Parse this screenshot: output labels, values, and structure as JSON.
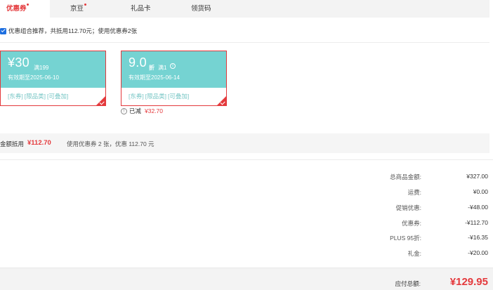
{
  "tabs": [
    {
      "label": "优惠券",
      "active": true,
      "dot": true
    },
    {
      "label": "京豆",
      "active": false,
      "dot": true
    },
    {
      "label": "礼品卡",
      "active": false,
      "dot": false
    },
    {
      "label": "领货码",
      "active": false,
      "dot": false
    }
  ],
  "recommend": {
    "checked": true,
    "text": "优惠组合推荐，共抵用112.70元；使用优惠券2张"
  },
  "coupons": [
    {
      "symbol": "¥",
      "amount": "30",
      "condition": "满199",
      "expiry": "有效期至2025-06-10",
      "tags": [
        "[东券]",
        "[限品类]",
        "[可叠加]"
      ],
      "selected": true
    },
    {
      "amount": "9.0",
      "unit": "折",
      "condition": "满1",
      "info_icon": "info-icon",
      "expiry": "有效期至2025-06-14",
      "tags": [
        "[东券]",
        "[限品类]",
        "[可叠加]"
      ],
      "selected": true
    }
  ],
  "saved": {
    "label": "已减",
    "amount": "¥32.70"
  },
  "summary": {
    "label": "金额抵用",
    "amount": "¥112.70",
    "desc": "使用优惠券 2 张，优惠 112.70 元"
  },
  "price_rows": [
    {
      "label": "总商品金额:",
      "value": "¥327.00"
    },
    {
      "label": "运费:",
      "value": "¥0.00"
    },
    {
      "label": "促销优惠:",
      "value": "-¥48.00"
    },
    {
      "label": "优惠券:",
      "value": "-¥112.70"
    },
    {
      "label": "PLUS 95折:",
      "value": "-¥16.35"
    },
    {
      "label": "礼金:",
      "value": "-¥20.00"
    }
  ],
  "total": {
    "label": "应付总额:",
    "value": "¥129.95"
  },
  "colors": {
    "accent": "#e4393c",
    "coupon_bg": "#75d3d2",
    "checkbox": "#1e6fe0"
  }
}
